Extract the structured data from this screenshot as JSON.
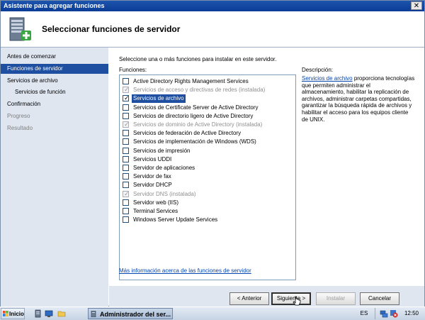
{
  "window": {
    "title": "Asistente para agregar funciones",
    "close_glyph": "✕"
  },
  "header": {
    "title": "Seleccionar funciones de servidor",
    "icon": "server-add-icon"
  },
  "sidebar": {
    "items": [
      {
        "label": "Antes de comenzar",
        "state": "normal"
      },
      {
        "label": "Funciones de servidor",
        "state": "active"
      },
      {
        "label": "Servicios de archivo",
        "state": "normal"
      },
      {
        "label": "Servicios de función",
        "state": "sub"
      },
      {
        "label": "Confirmación",
        "state": "normal"
      },
      {
        "label": "Progreso",
        "state": "dim"
      },
      {
        "label": "Resultado",
        "state": "dim"
      }
    ]
  },
  "main": {
    "intro": "Seleccione una o más funciones para instalar en este servidor.",
    "functions_label": "Funciones:",
    "roles": [
      {
        "label": "Active Directory Rights Management Services",
        "checked": false,
        "disabled": false,
        "selected": false
      },
      {
        "label": "Servicios de acceso y directivas de redes  (instalada)",
        "checked": true,
        "disabled": true,
        "selected": false
      },
      {
        "label": "Servicios de archivo",
        "checked": true,
        "disabled": false,
        "selected": true
      },
      {
        "label": "Servicios de Certificate Server de Active Directory",
        "checked": false,
        "disabled": false,
        "selected": false
      },
      {
        "label": "Servicios de directorio ligero de Active Directory",
        "checked": false,
        "disabled": false,
        "selected": false
      },
      {
        "label": "Servicios de dominio de Active Directory  (instalada)",
        "checked": true,
        "disabled": true,
        "selected": false
      },
      {
        "label": "Servicios de federación de Active Directory",
        "checked": false,
        "disabled": false,
        "selected": false
      },
      {
        "label": "Servicios de implementación de Windows (WDS)",
        "checked": false,
        "disabled": false,
        "selected": false
      },
      {
        "label": "Servicios de impresión",
        "checked": false,
        "disabled": false,
        "selected": false
      },
      {
        "label": "Servicios UDDI",
        "checked": false,
        "disabled": false,
        "selected": false
      },
      {
        "label": "Servidor de aplicaciones",
        "checked": false,
        "disabled": false,
        "selected": false
      },
      {
        "label": "Servidor de fax",
        "checked": false,
        "disabled": false,
        "selected": false
      },
      {
        "label": "Servidor DHCP",
        "checked": false,
        "disabled": false,
        "selected": false
      },
      {
        "label": "Servidor DNS  (instalada)",
        "checked": true,
        "disabled": true,
        "selected": false
      },
      {
        "label": "Servidor web (IIS)",
        "checked": false,
        "disabled": false,
        "selected": false
      },
      {
        "label": "Terminal Services",
        "checked": false,
        "disabled": false,
        "selected": false
      },
      {
        "label": "Windows Server Update Services",
        "checked": false,
        "disabled": false,
        "selected": false
      }
    ],
    "description_label": "Descripción:",
    "description_link": "Servicios de archivo",
    "description_text": " proporciona tecnologías que permiten administrar el almacenamiento, habilitar la replicación de archivos, administrar carpetas compartidas, garantizar la búsqueda rápida de archivos y habilitar el acceso para los equipos cliente de UNIX.",
    "more_info_link": "Más información acerca de las funciones de servidor"
  },
  "footer": {
    "back": "< Anterior",
    "next": "Siguiente >",
    "install": "Instalar",
    "cancel": "Cancelar"
  },
  "taskbar": {
    "start": "Inicio",
    "task_label": "Administrador del ser...",
    "language": "ES",
    "clock": "12:50"
  },
  "colors": {
    "accent": "#1e4fa0",
    "sidebar_bg": "#dfe6f0",
    "title_bar": "#0a3c96",
    "link": "#0645ad"
  }
}
